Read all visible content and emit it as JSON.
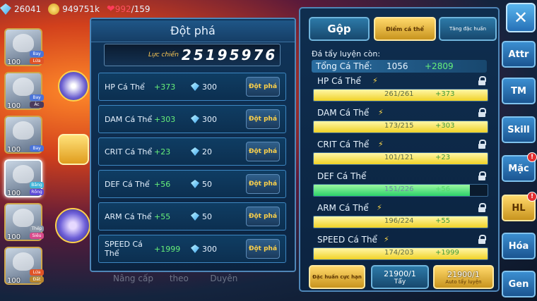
{
  "topbar": {
    "gems": "26041",
    "gold": "949751k",
    "hearts": "992",
    "hearts_max": "/159"
  },
  "team": [
    {
      "level": "100",
      "tags": [
        "Bay",
        "Lửa"
      ],
      "tag_colors": [
        "#4a73d8",
        "#e05326"
      ]
    },
    {
      "level": "100",
      "tags": [
        "Bay",
        "Ác"
      ],
      "tag_colors": [
        "#4a73d8",
        "#4a3a5c"
      ]
    },
    {
      "level": "100",
      "tags": [
        "",
        "Bay"
      ],
      "tag_colors": [
        "#4a73d8",
        "#4a73d8"
      ]
    },
    {
      "level": "100",
      "tags": [
        "Băng",
        "Rồng"
      ],
      "tag_colors": [
        "#3fb4d8",
        "#5c4ad8"
      ]
    },
    {
      "level": "100",
      "tags": [
        "Thép",
        "Siêu"
      ],
      "tag_colors": [
        "#8b98a8",
        "#d84a8b"
      ]
    },
    {
      "level": "100",
      "tags": [
        "Lửa",
        "Đất"
      ],
      "tag_colors": [
        "#e05326",
        "#b8862c"
      ]
    }
  ],
  "middle": {
    "title": "Đột phá",
    "power_label": "Lực chiến",
    "power_value": "25195976",
    "rows": [
      {
        "name": "HP Cá Thể",
        "add": "+373",
        "cost": "300",
        "button": "Đột phá"
      },
      {
        "name": "DAM Cá Thể",
        "add": "+303",
        "cost": "300",
        "button": "Đột phá"
      },
      {
        "name": "CRIT Cá Thể",
        "add": "+23",
        "cost": "20",
        "button": "Đột phá"
      },
      {
        "name": "DEF Cá Thể",
        "add": "+56",
        "cost": "50",
        "button": "Đột phá"
      },
      {
        "name": "ARM Cá Thể",
        "add": "+55",
        "cost": "50",
        "button": "Đột phá"
      },
      {
        "name": "SPEED Cá Thể",
        "add": "+1999",
        "cost": "300",
        "button": "Đột phá"
      }
    ],
    "bottom_tabs": [
      "Nâng cấp",
      "theo",
      "Duyên"
    ]
  },
  "right": {
    "tabs": {
      "gop": "Gộp",
      "diem": "Điểm cá thể",
      "tang": "Tăng đặc huấn"
    },
    "remain_label": "Đá tẩy luyện còn:",
    "total_label": "Tổng Cá Thể:",
    "total_value": "1056",
    "total_add": "+2809",
    "stats": [
      {
        "name": "HP Cá Thể",
        "value": "261/261",
        "add": "+373",
        "fill": 1.0,
        "locked": false
      },
      {
        "name": "DAM Cá Thể",
        "value": "173/215",
        "add": "+303",
        "fill": 1.0,
        "locked": false
      },
      {
        "name": "CRIT Cá Thể",
        "value": "101/121",
        "add": "+23",
        "fill": 1.0,
        "locked": false
      },
      {
        "name": "DEF Cá Thể",
        "value": "151/226",
        "add": "+56",
        "fill": 0.9,
        "locked": true
      },
      {
        "name": "ARM Cá Thể",
        "value": "196/224",
        "add": "+55",
        "fill": 1.0,
        "locked": false
      },
      {
        "name": "SPEED Cá Thể",
        "value": "174/203",
        "add": "+1999",
        "fill": 1.0,
        "locked": false
      }
    ],
    "buttons": {
      "dac_huan": "Đặc huấn cực hạn",
      "tay_count": "21900/1",
      "tay_label": "Tẩy",
      "auto_count": "21900/1",
      "auto_label": "Auto tẩy luyện"
    }
  },
  "sidenav": [
    "Attr",
    "TM",
    "Skill",
    "Mặc",
    "HL",
    "Hóa",
    "Gen"
  ],
  "sidenav_badge": "!"
}
